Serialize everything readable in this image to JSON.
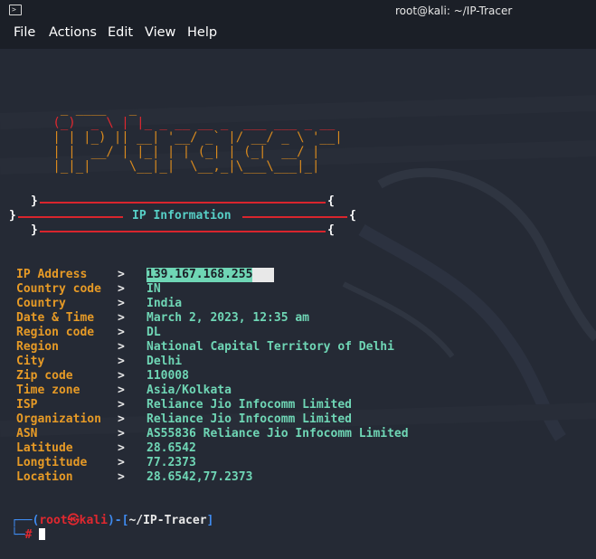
{
  "window": {
    "title": "root@kali: ~/IP-Tracer"
  },
  "menu": {
    "items": [
      "File",
      "Actions",
      "Edit",
      "View",
      "Help"
    ]
  },
  "banner": {
    "ascii_lines": [
      "  _ ____   _",
      " (_)  _ \\ | |_ _ __ __ _  ___ ___ _ __",
      " | | |_) || __| '__/ _` |/ __/ _ \\ '__|",
      " | |  __/ | |_| | | (_| | (_|  __/ |",
      " |_|_|     \\__|_|  \\__,_|\\___\\___|_|"
    ]
  },
  "header": {
    "title": "IP Information",
    "open_brace": "{",
    "close_brace": "}"
  },
  "info": {
    "separator": ">",
    "rows": [
      {
        "label": "IP Address",
        "value": "139.167.168.255"
      },
      {
        "label": "Country code",
        "value": "IN"
      },
      {
        "label": "Country",
        "value": "India"
      },
      {
        "label": "Date & Time",
        "value": "March 2, 2023, 12:35 am"
      },
      {
        "label": "Region code",
        "value": "DL"
      },
      {
        "label": "Region",
        "value": "National Capital Territory of Delhi"
      },
      {
        "label": "City",
        "value": "Delhi"
      },
      {
        "label": "Zip code",
        "value": "110008"
      },
      {
        "label": "Time zone",
        "value": "Asia/Kolkata"
      },
      {
        "label": "ISP",
        "value": "Reliance Jio Infocomm Limited"
      },
      {
        "label": "Organization",
        "value": "Reliance Jio Infocomm Limited"
      },
      {
        "label": "ASN",
        "value": "AS55836 Reliance Jio Infocomm Limited"
      },
      {
        "label": "Latitude",
        "value": "28.6542"
      },
      {
        "label": "Longtitude",
        "value": "77.2373"
      },
      {
        "label": "Location",
        "value": "28.6542,77.2373"
      }
    ]
  },
  "prompt": {
    "corner_top": "┌──(",
    "user": "root",
    "at_symbol": "㉿",
    "host": "kali",
    "mid": ")-[",
    "path": "~/IP-Tracer",
    "end": "]",
    "corner_bottom": "└─",
    "hash": "#"
  },
  "colors": {
    "background": "#252a35",
    "label": "#e69a26",
    "value": "#6fd6b5",
    "accent_red": "#d9252d",
    "banner": "#d98a1e",
    "prompt_blue": "#3f8bf0"
  }
}
